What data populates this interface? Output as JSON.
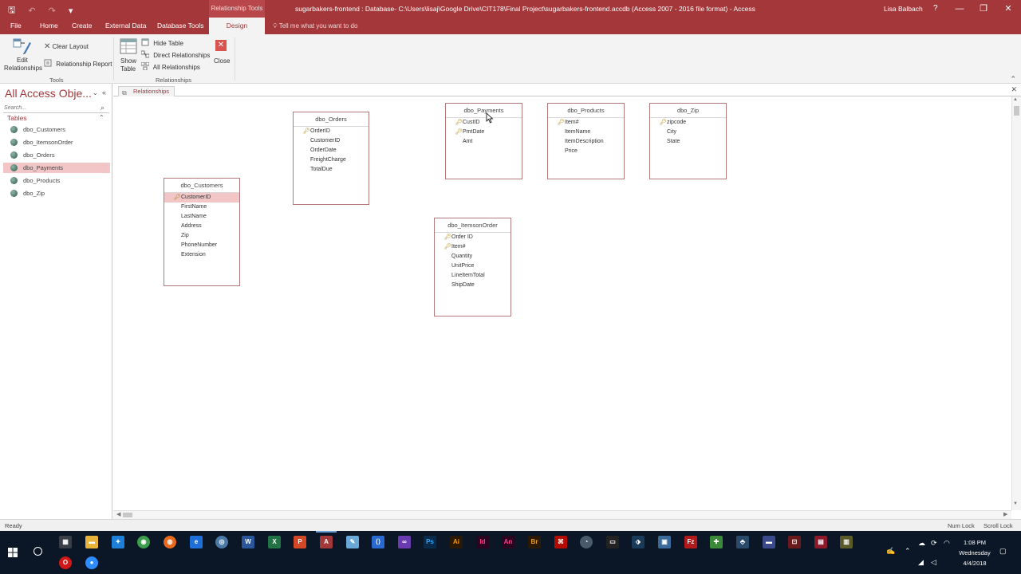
{
  "window": {
    "context_tab": "Relationship Tools",
    "title": "sugarbakers-frontend : Database- C:\\Users\\lisaj\\Google Drive\\CIT178\\Final Project\\sugarbakers-frontend.accdb (Access 2007 - 2016 file format)  -  Access",
    "user": "Lisa Balbach",
    "help": "?",
    "minimize": "—",
    "restore": "❐",
    "close": "✕"
  },
  "ribbon_tabs": [
    {
      "label": "File"
    },
    {
      "label": "Home"
    },
    {
      "label": "Create"
    },
    {
      "label": "External Data"
    },
    {
      "label": "Database Tools"
    },
    {
      "label": "Design",
      "active": true
    }
  ],
  "tell_me": "Tell me what you want to do",
  "ribbon": {
    "edit_relationships_line1": "Edit",
    "edit_relationships_line2": "Relationships",
    "clear_layout": "Clear Layout",
    "relationship_report": "Relationship Report",
    "tools_group": "Tools",
    "show_table_line1": "Show",
    "show_table_line2": "Table",
    "hide_table": "Hide Table",
    "direct_relationships": "Direct Relationships",
    "all_relationships": "All Relationships",
    "close": "Close",
    "relationships_group": "Relationships"
  },
  "nav": {
    "title": "All Access Obje...",
    "search_placeholder": "Search...",
    "section": "Tables",
    "items": [
      {
        "label": "dbo_Customers"
      },
      {
        "label": "dbo_ItemsonOrder"
      },
      {
        "label": "dbo_Orders"
      },
      {
        "label": "dbo_Payments",
        "selected": true
      },
      {
        "label": "dbo_Products"
      },
      {
        "label": "dbo_Zip"
      }
    ]
  },
  "document_tab": "Relationships",
  "tables": {
    "orders": {
      "title": "dbo_Orders",
      "fields": [
        {
          "name": "OrderID",
          "key": true
        },
        {
          "name": "CustomerID"
        },
        {
          "name": "OrderDate"
        },
        {
          "name": "FreightCharge"
        },
        {
          "name": "TotalDue"
        }
      ]
    },
    "payments": {
      "title": "dbo_Payments",
      "fields": [
        {
          "name": "CustID",
          "key": true
        },
        {
          "name": "PmtDate",
          "key": true
        },
        {
          "name": "Amt"
        }
      ]
    },
    "products": {
      "title": "dbo_Products",
      "fields": [
        {
          "name": "Item#",
          "key": true
        },
        {
          "name": "ItemName"
        },
        {
          "name": "ItemDescription"
        },
        {
          "name": "Price"
        }
      ]
    },
    "zip": {
      "title": "dbo_Zip",
      "fields": [
        {
          "name": "zipcode",
          "key": true
        },
        {
          "name": "City"
        },
        {
          "name": "State"
        }
      ]
    },
    "customers": {
      "title": "dbo_Customers",
      "fields": [
        {
          "name": "CustomerID",
          "key": true,
          "selected": true
        },
        {
          "name": "FirstName"
        },
        {
          "name": "LastName"
        },
        {
          "name": "Address"
        },
        {
          "name": "Zip"
        },
        {
          "name": "PhoneNumber"
        },
        {
          "name": "Extension"
        }
      ]
    },
    "itemsonorder": {
      "title": "dbo_ItemsonOrder",
      "fields": [
        {
          "name": "Order ID",
          "key": true
        },
        {
          "name": "Item#",
          "key": true
        },
        {
          "name": "Quantity"
        },
        {
          "name": "UnitPrice"
        },
        {
          "name": "LineItemTotal"
        },
        {
          "name": "ShipDate"
        }
      ]
    }
  },
  "status": {
    "text": "Ready",
    "num_lock": "Num Lock",
    "scroll_lock": "Scroll Lock"
  },
  "taskbar": {
    "time": "1:08 PM",
    "day": "Wednesday",
    "date": "4/4/2018"
  },
  "colors": {
    "accent": "#a4373a",
    "selection": "#f2c6c7",
    "taskbar": "#0b1626"
  }
}
